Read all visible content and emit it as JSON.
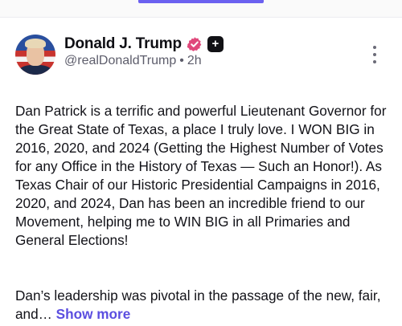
{
  "post": {
    "author": {
      "display_name": "Donald J. Trump",
      "handle": "@realDonaldTrump",
      "separator": "•",
      "time_ago": "2h"
    },
    "badges": {
      "verified_icon": "verified-badge-icon",
      "plus_symbol": "+"
    },
    "text_paragraph_1": "Dan Patrick is a terrific and powerful Lieutenant Governor for the Great State of Texas, a place I truly love. I WON BIG in 2016, 2020, and 2024 (Getting the Highest Number of Votes for any Office in the History of Texas — Such an Honor!). As Texas Chair of our Historic Presidential Campaigns in 2016, 2020, and 2024, Dan has been an incredible friend to our Movement, helping me to WIN BIG in all Primaries and General Elections!",
    "text_paragraph_2": "Dan’s leadership was pivotal in the passage of the new, fair, and…",
    "show_more_label": "Show more"
  },
  "colors": {
    "accent": "#6b61f0",
    "verified": "#e0487b",
    "link": "#5b4ee0"
  }
}
